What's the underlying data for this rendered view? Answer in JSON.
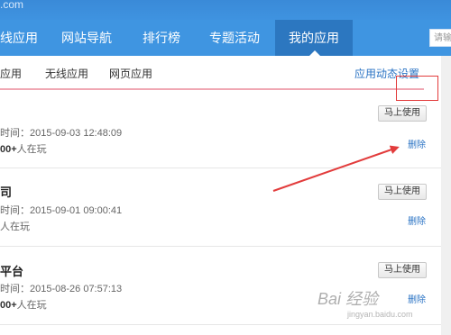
{
  "top": {
    "url_fragment": ".com"
  },
  "nav": {
    "items": [
      "线应用",
      "网站导航",
      "排行榜",
      "专题活动",
      "我的应用"
    ],
    "search_placeholder": "请输"
  },
  "subtabs": {
    "items": [
      "应用",
      "无线应用",
      "网页应用"
    ],
    "settings": "应用动态设置"
  },
  "apps": [
    {
      "title": "",
      "time": "时间：2015-09-03 12:48:09",
      "players_bold": "00+",
      "players_text": "人在玩",
      "use": "马上使用",
      "delete": "删除"
    },
    {
      "title": "司",
      "time": "时间：2015-09-01 09:00:41",
      "players_bold": "",
      "players_text": "人在玩",
      "use": "马上使用",
      "delete": "删除"
    },
    {
      "title": "平台",
      "time": "时间：2015-08-26 07:57:13",
      "players_bold": "00+",
      "players_text": "人在玩",
      "use": "马上使用",
      "delete": "删除"
    }
  ],
  "watermark": {
    "main": "Bai 经验",
    "sub": "jingyan.baidu.com"
  },
  "colors": {
    "nav_blue": "#3f95e1",
    "nav_active": "#2c77c0",
    "link_blue": "#2a73c4",
    "annotation_red": "#e23c3c"
  }
}
